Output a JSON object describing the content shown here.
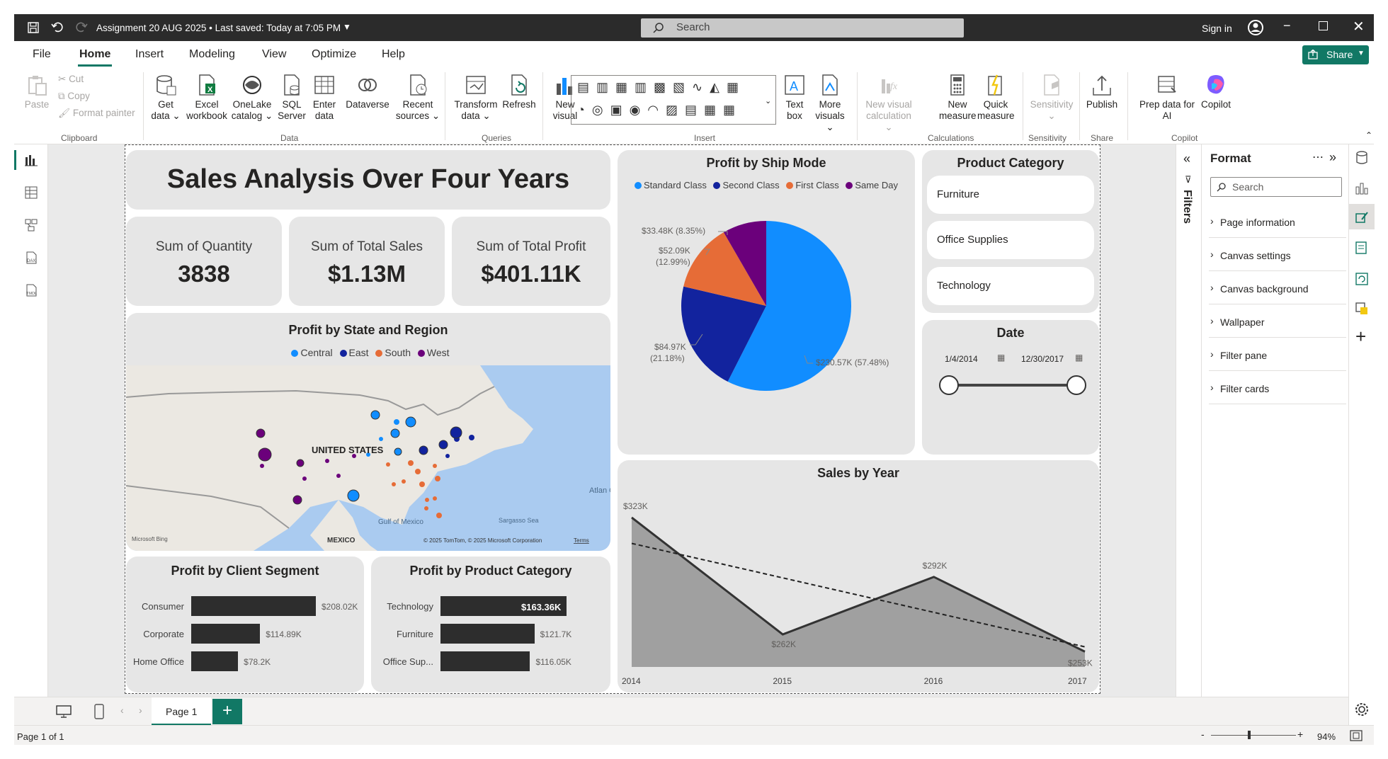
{
  "titlebar": {
    "doc_title": "Assignment 20 AUG 2025 • Last saved: Today at 7:05 PM",
    "search_placeholder": "Search",
    "sign_in": "Sign in"
  },
  "ribbon": {
    "tabs": [
      "File",
      "Home",
      "Insert",
      "Modeling",
      "View",
      "Optimize",
      "Help"
    ],
    "active_tab": "Home",
    "share": "Share",
    "clipboard": {
      "paste": "Paste",
      "cut": "Cut",
      "copy": "Copy",
      "format_painter": "Format painter",
      "group": "Clipboard"
    },
    "data": {
      "get_data": [
        "Get",
        "data"
      ],
      "excel": [
        "Excel",
        "workbook"
      ],
      "onelake": [
        "OneLake",
        "catalog"
      ],
      "sql": [
        "SQL",
        "Server"
      ],
      "enter": [
        "Enter",
        "data"
      ],
      "dataverse": "Dataverse",
      "recent": [
        "Recent",
        "sources"
      ],
      "group": "Data"
    },
    "queries": {
      "transform": [
        "Transform",
        "data"
      ],
      "refresh": "Refresh",
      "group": "Queries"
    },
    "insert": {
      "new_visual": [
        "New",
        "visual"
      ],
      "text_box": [
        "Text",
        "box"
      ],
      "more_visuals": [
        "More",
        "visuals"
      ],
      "group": "Insert"
    },
    "calculations": {
      "new_visual_calc": [
        "New visual",
        "calculation"
      ],
      "new_measure": [
        "New",
        "measure"
      ],
      "quick_measure": [
        "Quick",
        "measure"
      ],
      "group": "Calculations"
    },
    "sensitivity": {
      "label": "Sensitivity",
      "group": "Sensitivity"
    },
    "share_grp": {
      "publish": "Publish",
      "group": "Share"
    },
    "copilot": {
      "prep": [
        "Prep data for",
        "AI"
      ],
      "copilot": "Copilot",
      "group": "Copilot"
    }
  },
  "dashboard": {
    "title": "Sales Analysis Over Four Years",
    "kpis": [
      {
        "label": "Sum of Quantity",
        "value": "3838"
      },
      {
        "label": "Sum of Total Sales",
        "value": "$1.13M"
      },
      {
        "label": "Sum of Total Profit",
        "value": "$401.11K"
      }
    ],
    "map": {
      "title": "Profit by State and Region",
      "legend": [
        {
          "name": "Central",
          "color": "#118dff"
        },
        {
          "name": "East",
          "color": "#12239e"
        },
        {
          "name": "South",
          "color": "#e66c37"
        },
        {
          "name": "West",
          "color": "#6b007b"
        }
      ],
      "labels": {
        "country": "UNITED STATES",
        "mexico": "MEXICO",
        "gulf": "Gulf of Mexico",
        "sargasso": "Sargasso Sea",
        "atlantic": "Atlan Oce",
        "bing": "Microsoft Bing",
        "copyright": "© 2025 TomTom, © 2025 Microsoft Corporation",
        "terms": "Terms"
      }
    },
    "ship_mode": {
      "title": "Profit by Ship Mode",
      "legend": [
        {
          "name": "Standard Class",
          "color": "#118dff"
        },
        {
          "name": "Second Class",
          "color": "#12239e"
        },
        {
          "name": "First Class",
          "color": "#e66c37"
        },
        {
          "name": "Same Day",
          "color": "#6b007b"
        }
      ],
      "labels": {
        "standard": "$230.57K (57.48%)",
        "second_a": "$84.97K",
        "second_b": "(21.18%)",
        "first_a": "$52.09K",
        "first_b": "(12.99%)",
        "same_day": "$33.48K (8.35%)"
      }
    },
    "category_slicer": {
      "title": "Product Category",
      "items": [
        "Furniture",
        "Office Supplies",
        "Technology"
      ]
    },
    "date_slicer": {
      "title": "Date",
      "start": "1/4/2014",
      "end": "12/30/2017",
      "range_fraction": [
        0,
        1
      ]
    },
    "client_segment": {
      "title": "Profit by Client Segment"
    },
    "product_category": {
      "title": "Profit by Product Category"
    },
    "sales_by_year": {
      "title": "Sales by Year"
    }
  },
  "chart_data": [
    {
      "type": "pie",
      "title": "Profit by Ship Mode",
      "categories": [
        "Standard Class",
        "Second Class",
        "First Class",
        "Same Day"
      ],
      "values": [
        230.57,
        84.97,
        52.09,
        33.48
      ],
      "percent": [
        57.48,
        21.18,
        12.99,
        8.35
      ],
      "colors": [
        "#118dff",
        "#12239e",
        "#e66c37",
        "#6b007b"
      ]
    },
    {
      "type": "bar",
      "title": "Profit by Client Segment",
      "categories": [
        "Consumer",
        "Corporate",
        "Home Office"
      ],
      "values": [
        208.02,
        114.89,
        78.2
      ],
      "value_labels": [
        "$208.02K",
        "$114.89K",
        "$78.2K"
      ],
      "xlim": [
        0,
        208.02
      ]
    },
    {
      "type": "bar",
      "title": "Profit by Product Category",
      "categories": [
        "Technology",
        "Furniture",
        "Office Sup..."
      ],
      "values": [
        163.36,
        121.7,
        116.05
      ],
      "value_labels": [
        "$163.36K",
        "$121.7K",
        "$116.05K"
      ],
      "xlim": [
        0,
        163.36
      ]
    },
    {
      "type": "area",
      "title": "Sales by Year",
      "x": [
        "2014",
        "2015",
        "2016",
        "2017"
      ],
      "values": [
        323,
        262,
        292,
        253
      ],
      "value_labels": [
        "$323K",
        "$262K",
        "$292K",
        "$253K"
      ],
      "trend_line": true,
      "ylim": [
        245,
        330
      ]
    }
  ],
  "filters_label": "Filters",
  "format_pane": {
    "title": "Format",
    "search_placeholder": "Search",
    "sections": [
      "Page information",
      "Canvas settings",
      "Canvas background",
      "Wallpaper",
      "Filter pane",
      "Filter cards"
    ]
  },
  "pages": {
    "tab": "Page 1",
    "add": "+"
  },
  "status": {
    "page": "Page 1 of 1",
    "zoom": "94%"
  }
}
